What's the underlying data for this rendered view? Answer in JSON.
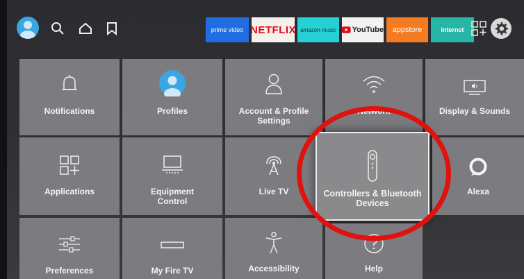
{
  "topbar": {
    "apps": [
      {
        "id": "prime",
        "label": "prime video"
      },
      {
        "id": "netflix",
        "label": "NETFLIX"
      },
      {
        "id": "amusic",
        "label": "amazon music"
      },
      {
        "id": "youtube",
        "label": "YouTube"
      },
      {
        "id": "appstore",
        "label": "appstore"
      },
      {
        "id": "internet",
        "label": "internet"
      }
    ]
  },
  "tiles": {
    "notifications": "Notifications",
    "profiles": "Profiles",
    "account_line1": "Account & Profile",
    "account_line2": "Settings",
    "network": "Network",
    "display": "Display & Sounds",
    "applications": "Applications",
    "equipment_line1": "Equipment",
    "equipment_line2": "Control",
    "livetv": "Live TV",
    "controllers_line1": "Controllers & Bluetooth",
    "controllers_line2": "Devices",
    "alexa": "Alexa",
    "preferences": "Preferences",
    "myfiretv": "My Fire TV",
    "accessibility": "Accessibility",
    "help": "Help"
  },
  "colors": {
    "tile": "#7c7c80",
    "focus_border": "#f0f0f0",
    "annotation": "#e0120f",
    "avatar": "#3aa6e3"
  }
}
